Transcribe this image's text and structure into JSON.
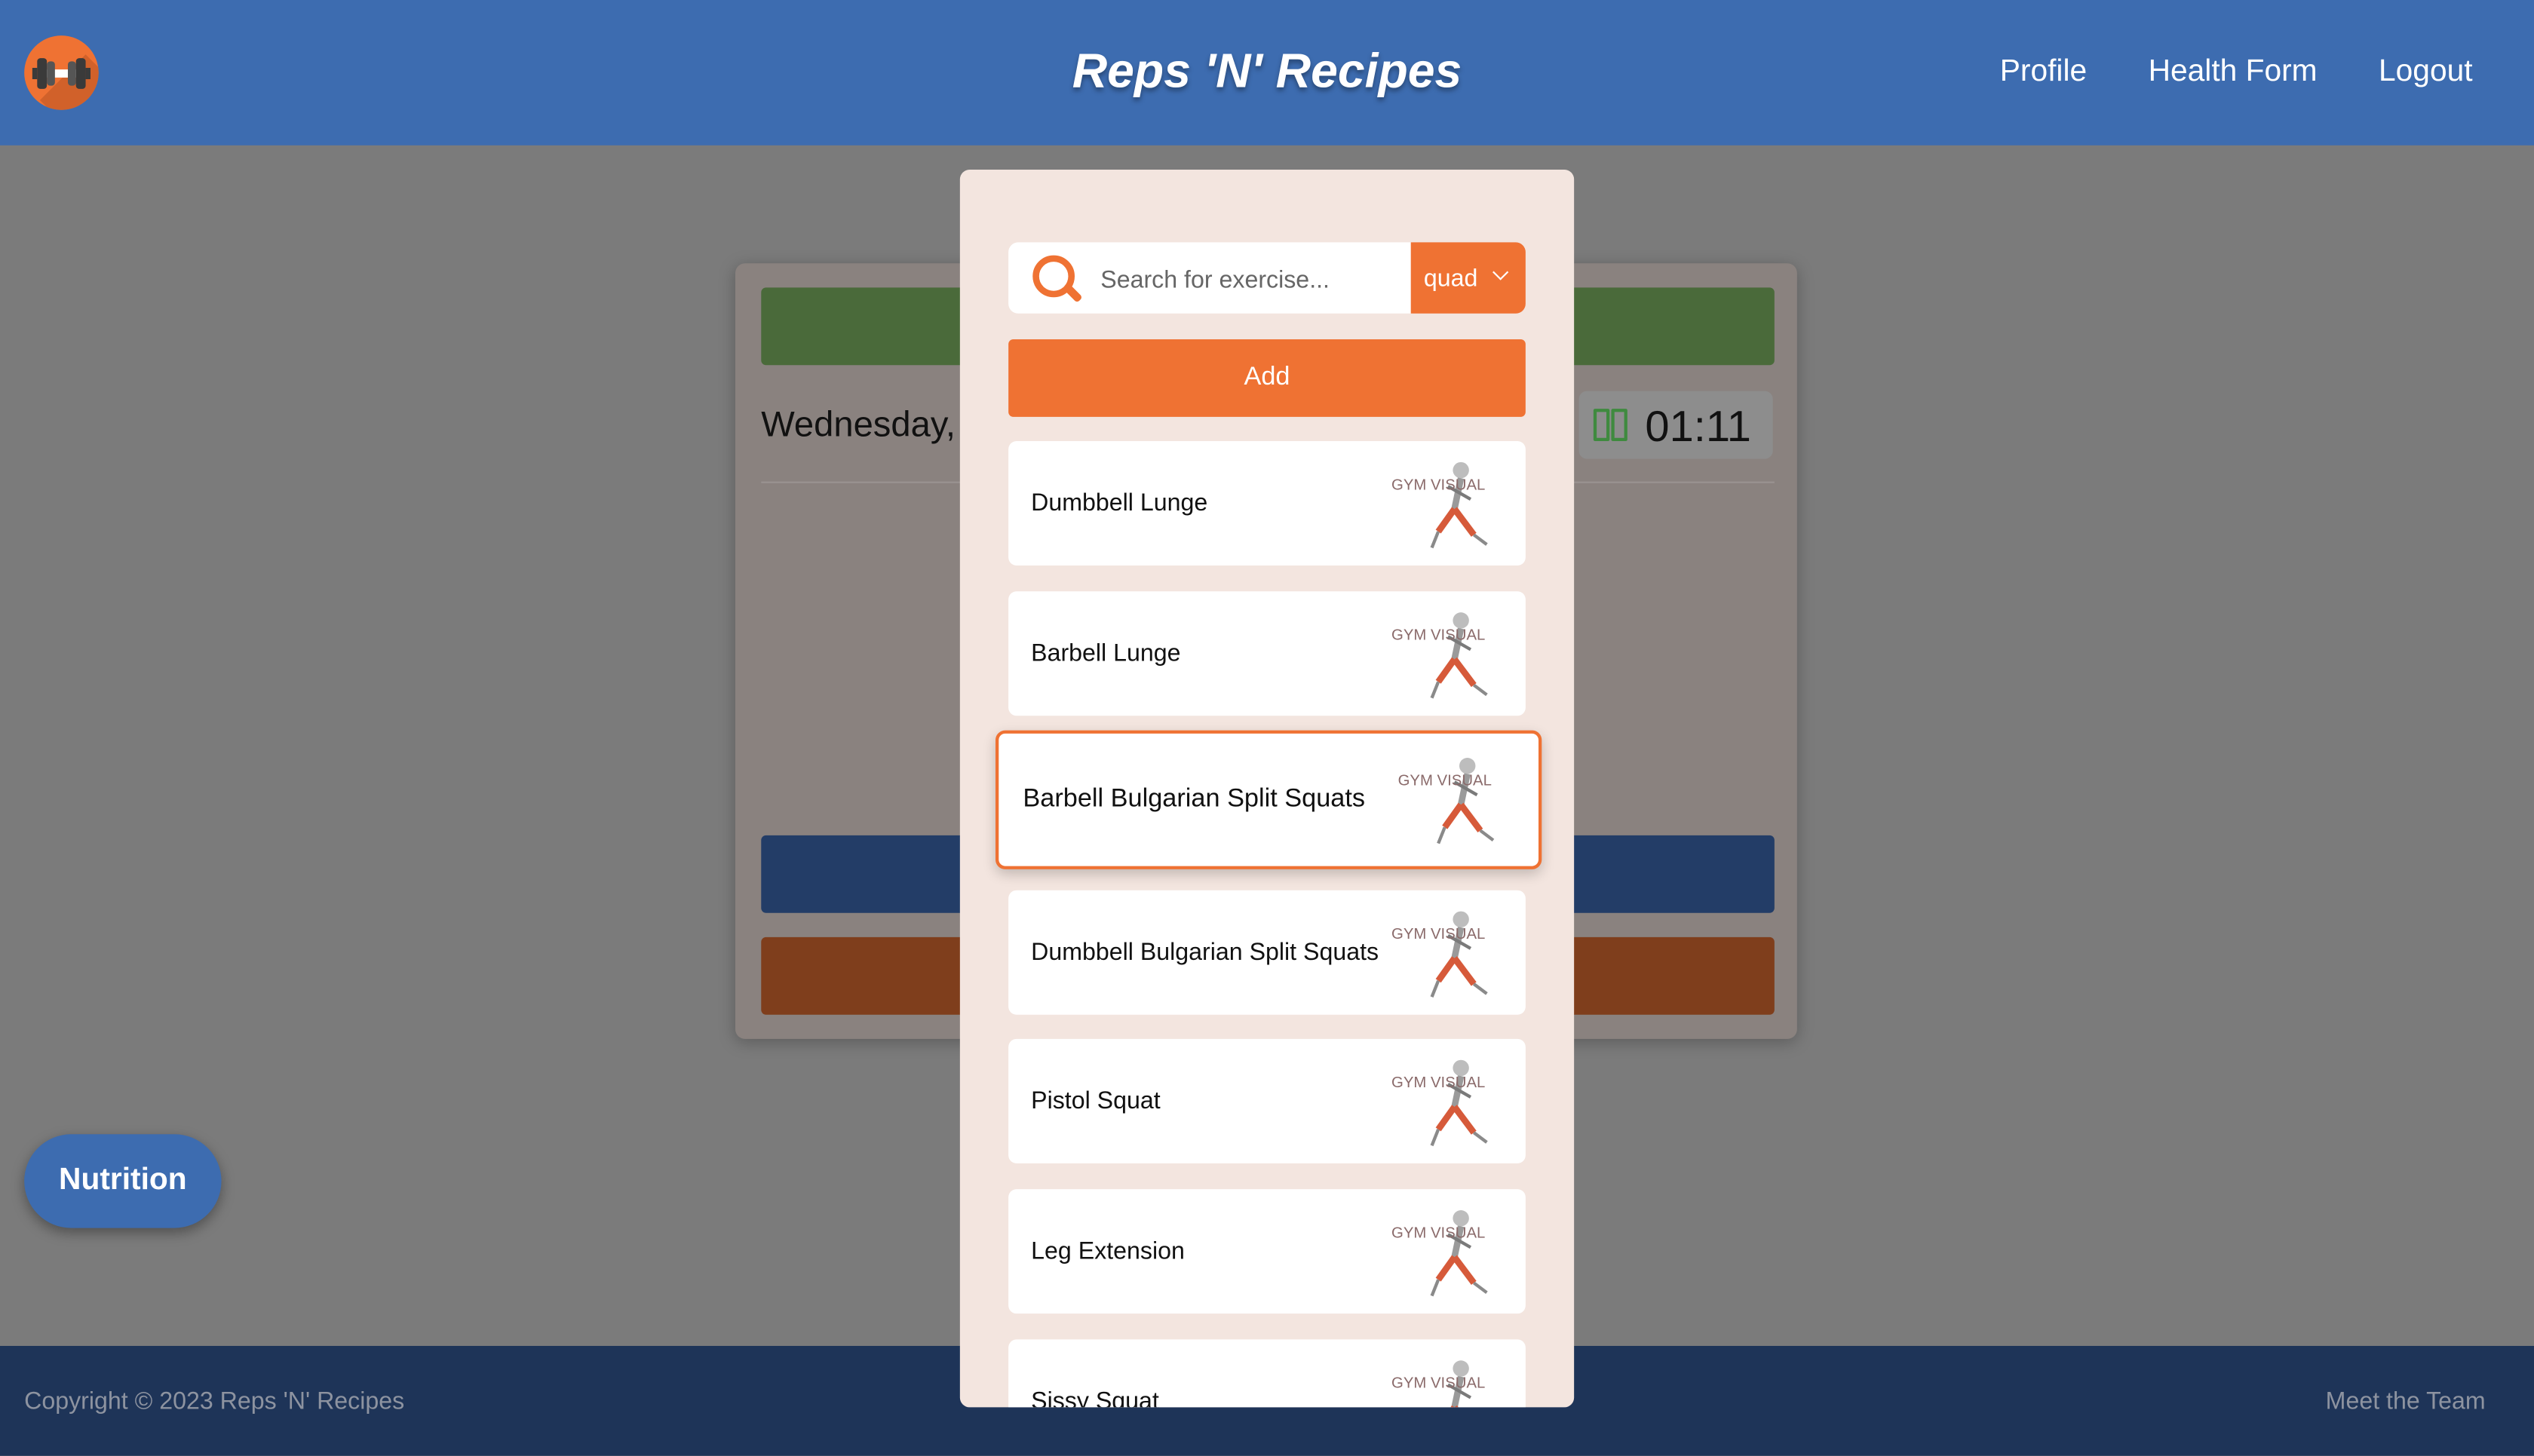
{
  "header": {
    "brand": "Reps 'N' Recipes",
    "nav": [
      "Profile",
      "Health Form",
      "Logout"
    ]
  },
  "workout": {
    "date_partial": "Wednesday, ",
    "timer": "01:11"
  },
  "nutrition_button": "Nutrition",
  "modal": {
    "search_placeholder": "Search for exercise...",
    "filter_value": "quad",
    "add_label": "Add",
    "exercises": [
      "Dumbbell Lunge",
      "Barbell Lunge",
      "Barbell Bulgarian Split Squats",
      "Dumbbell Bulgarian Split Squats",
      "Pistol Squat",
      "Leg Extension",
      "Sissy Squat"
    ],
    "selected_index": 2,
    "thumb_text": "GYM VISUAL"
  },
  "footer": {
    "copyright": "Copyright © 2023 Reps 'N' Recipes",
    "team_link": "Meet the Team"
  },
  "colors": {
    "nav": "#3d6cb0",
    "accent": "#ef7233",
    "footer": "#1e3458",
    "modal": "#f3e5df"
  }
}
